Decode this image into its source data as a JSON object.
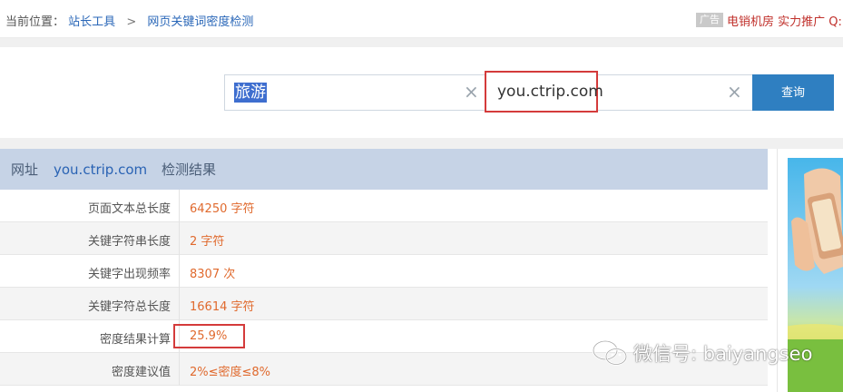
{
  "breadcrumb": {
    "prefix": "当前位置：",
    "home": "站长工具",
    "separator": ">",
    "current": "网页关键词密度检测"
  },
  "ad": {
    "tag": "广告",
    "text": "电销机房 实力推广 Q:"
  },
  "search": {
    "keyword": "旅游",
    "url": "you.ctrip.com",
    "button_label": "查询",
    "clear_icon": "×"
  },
  "results": {
    "header_label": "网址",
    "header_url": "you.ctrip.com",
    "header_result": "检测结果",
    "rows": [
      {
        "label": "页面文本总长度",
        "value": "64250 字符"
      },
      {
        "label": "关键字符串长度",
        "value": "2 字符"
      },
      {
        "label": "关键字出现频率",
        "value": "8307 次"
      },
      {
        "label": "关键字符总长度",
        "value": "16614 字符"
      },
      {
        "label": "密度结果计算",
        "value": "25.9%"
      },
      {
        "label": "密度建议值",
        "value": "2%≤密度≤8%"
      }
    ]
  },
  "watermark": {
    "icon": "wechat-icon",
    "text": "微信号: baiyangseo"
  },
  "colors": {
    "link": "#2a67b8",
    "accent_button": "#2f7fc1",
    "value_orange": "#e06a2e",
    "highlight_red": "#d43b3b",
    "header_bg": "#c6d3e6"
  }
}
